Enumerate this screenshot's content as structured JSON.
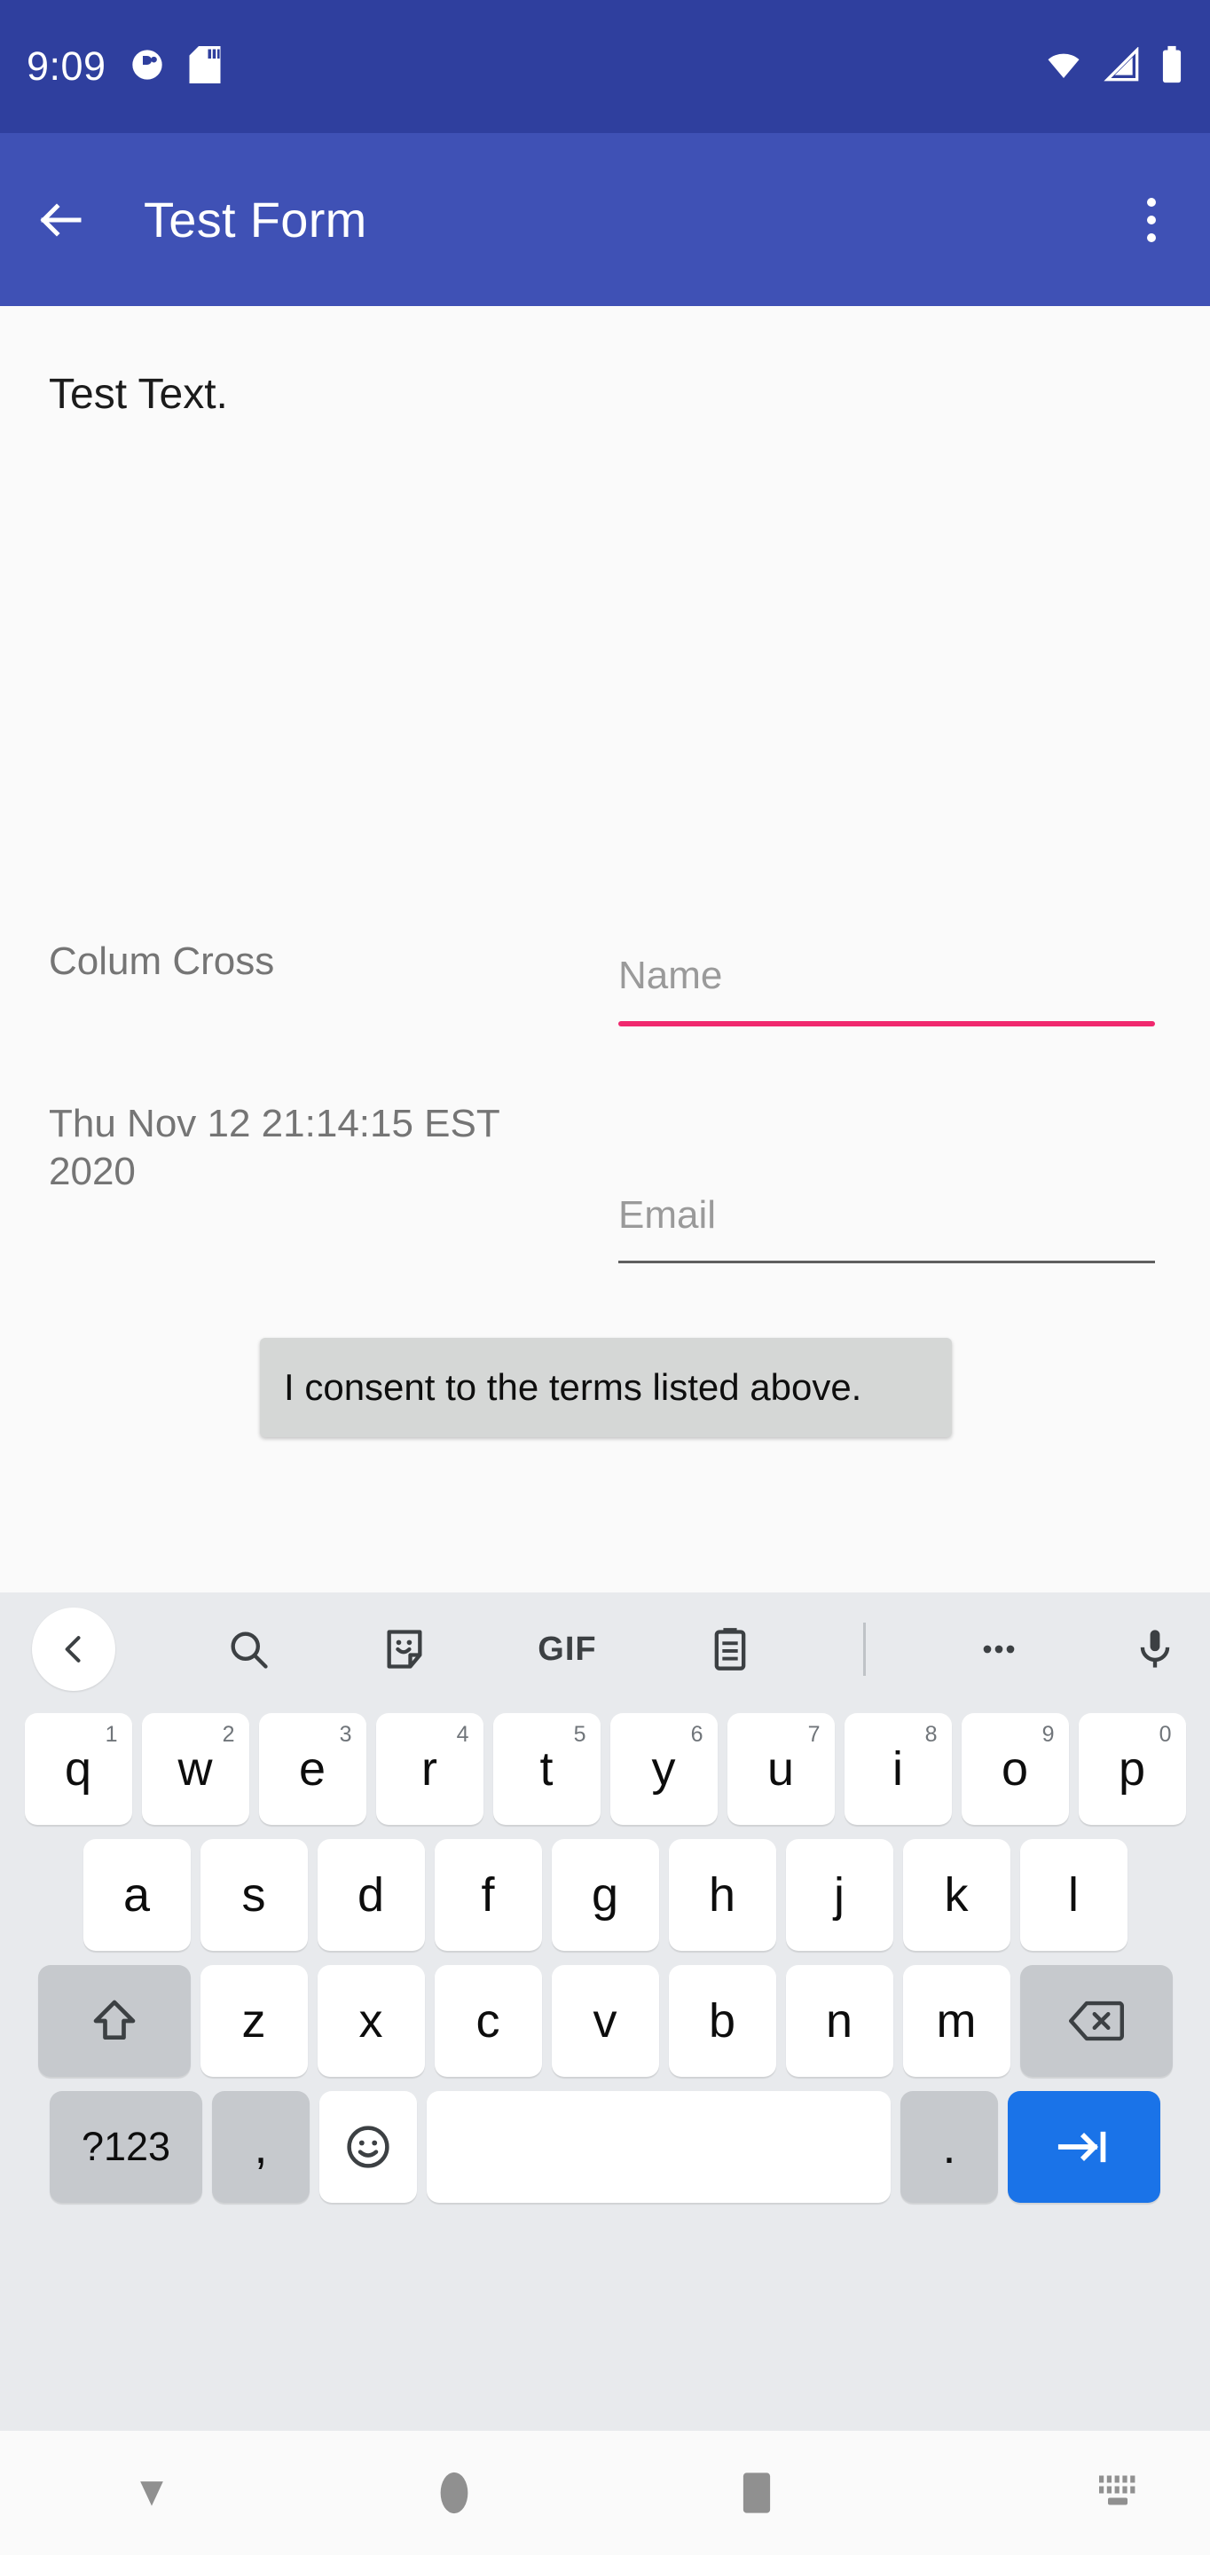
{
  "status_bar": {
    "time": "9:09",
    "background": "#2f3f9e",
    "icons": [
      "app-notification-icon",
      "sd-card-icon",
      "wifi-icon",
      "cellular-signal-icon",
      "battery-icon"
    ]
  },
  "app_bar": {
    "title": "Test Form",
    "background": "#3f51b5",
    "back_label": "back-arrow-icon",
    "overflow_label": "overflow-menu-icon"
  },
  "content": {
    "test_text": "Test Text.",
    "rows": [
      {
        "label": "Colum Cross",
        "field_placeholder": "Name",
        "field_value": "",
        "focused": true,
        "underline_color": "#f0286e"
      },
      {
        "label": "Thu Nov 12 21:14:15 EST 2020",
        "field_placeholder": "Email",
        "field_value": "",
        "focused": false,
        "underline_color": "#5f5f5f"
      }
    ],
    "tooltip": {
      "text": "I consent to the terms listed above.",
      "background": "#d5d7d6"
    }
  },
  "keyboard": {
    "background": "#e8eaed",
    "toolbar": [
      {
        "name": "expand-toolbar-icon",
        "label": "‹"
      },
      {
        "name": "search-icon",
        "label": "search"
      },
      {
        "name": "sticker-icon",
        "label": "sticker"
      },
      {
        "name": "gif-icon",
        "label": "GIF"
      },
      {
        "name": "clipboard-icon",
        "label": "clipboard"
      },
      {
        "name": "toolbar-divider",
        "label": ""
      },
      {
        "name": "more-options-icon",
        "label": "•••"
      },
      {
        "name": "microphone-icon",
        "label": "mic"
      }
    ],
    "row1": [
      {
        "letter": "q",
        "number": "1"
      },
      {
        "letter": "w",
        "number": "2"
      },
      {
        "letter": "e",
        "number": "3"
      },
      {
        "letter": "r",
        "number": "4"
      },
      {
        "letter": "t",
        "number": "5"
      },
      {
        "letter": "y",
        "number": "6"
      },
      {
        "letter": "u",
        "number": "7"
      },
      {
        "letter": "i",
        "number": "8"
      },
      {
        "letter": "o",
        "number": "9"
      },
      {
        "letter": "p",
        "number": "0"
      }
    ],
    "row2": [
      {
        "letter": "a"
      },
      {
        "letter": "s"
      },
      {
        "letter": "d"
      },
      {
        "letter": "f"
      },
      {
        "letter": "g"
      },
      {
        "letter": "h"
      },
      {
        "letter": "j"
      },
      {
        "letter": "k"
      },
      {
        "letter": "l"
      }
    ],
    "row3": [
      {
        "letter": "z"
      },
      {
        "letter": "x"
      },
      {
        "letter": "c"
      },
      {
        "letter": "v"
      },
      {
        "letter": "b"
      },
      {
        "letter": "n"
      },
      {
        "letter": "m"
      }
    ],
    "shift_label": "shift-key-icon",
    "backspace_label": "backspace-key-icon",
    "symbols_label": "?123",
    "comma_label": ",",
    "emoji_label": "emoji-key-icon",
    "space_label": "",
    "period_label": ".",
    "enter_label": "next-key-icon",
    "enter_color": "#1a73e8"
  },
  "nav_bar": {
    "buttons": [
      {
        "name": "hide-keyboard-icon",
        "label": "back"
      },
      {
        "name": "home-icon",
        "label": "home"
      },
      {
        "name": "recents-icon",
        "label": "recents"
      },
      {
        "name": "ime-switcher-icon",
        "label": "switch-keyboard"
      }
    ]
  }
}
